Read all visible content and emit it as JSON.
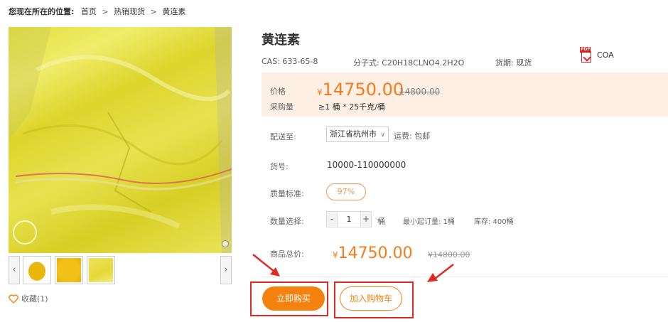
{
  "breadcrumb": {
    "lead": "您现在所在的位置:",
    "items": [
      "首页",
      "热销现货",
      "黄连素"
    ],
    "separator": ">"
  },
  "gallery": {
    "prev_arrow": "‹",
    "next_arrow": "›",
    "thumbnail_count": 3
  },
  "favorite": {
    "label": "收藏(1)"
  },
  "product": {
    "title": "黄连素",
    "cas": "CAS:  633-65-8",
    "formula": "分子式: C20H18CLNO4.2H2O",
    "delivery_period": "货期:  现货",
    "coa_label": "COA",
    "pdf_tag": "PDF"
  },
  "price_panel": {
    "price_label": "价格",
    "purchase_label": "采购量",
    "currency": "¥",
    "price": "14750.00",
    "old_price": "14800.00",
    "purchase_qty": "≥1 桶 * 25千克/桶"
  },
  "shipping": {
    "label": "配送至:",
    "location": "浙江省杭州市",
    "fee": "运费: 包邮"
  },
  "sku": {
    "label": "货号:",
    "value": "10000-110000000"
  },
  "quality": {
    "label": "质量标准:",
    "value": "97%"
  },
  "quantity": {
    "label": "数量选择:",
    "minus": "-",
    "value": "1",
    "plus": "+",
    "unit": "桶",
    "min_order": "最小起订量: 1桶",
    "stock": "库存: 400桶"
  },
  "total": {
    "label": "商品总价:",
    "currency": "¥",
    "value": "14750.00",
    "old_value": "¥14800.00"
  },
  "actions": {
    "buy_now": "立即购买",
    "add_to_cart": "加入购物车"
  },
  "colors": {
    "accent": "#f5820f",
    "price_panel_bg": "#fdefe4",
    "highlight_red": "#e02a22"
  }
}
